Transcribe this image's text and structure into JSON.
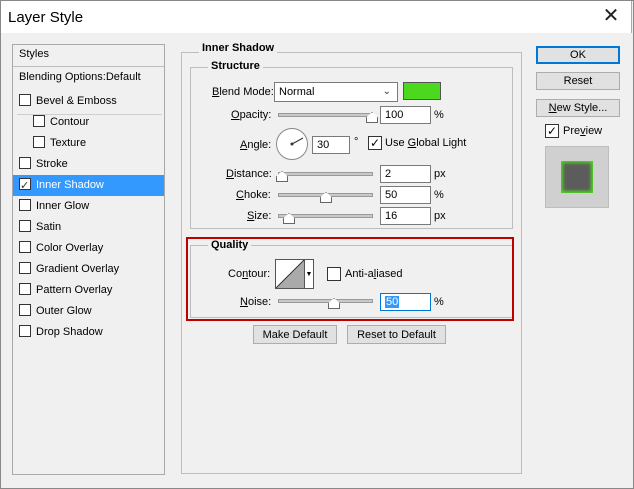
{
  "window": {
    "title": "Layer Style",
    "close": "✕"
  },
  "styles_panel": {
    "header": "Styles",
    "blending": "Blending Options:Default",
    "items": [
      {
        "label": "Bevel & Emboss",
        "checked": false
      },
      {
        "label": "Contour",
        "checked": false
      },
      {
        "label": "Texture",
        "checked": false
      },
      {
        "label": "Stroke",
        "checked": false
      },
      {
        "label": "Inner Shadow",
        "checked": true
      },
      {
        "label": "Inner Glow",
        "checked": false
      },
      {
        "label": "Satin",
        "checked": false
      },
      {
        "label": "Color Overlay",
        "checked": false
      },
      {
        "label": "Gradient Overlay",
        "checked": false
      },
      {
        "label": "Pattern Overlay",
        "checked": false
      },
      {
        "label": "Outer Glow",
        "checked": false
      },
      {
        "label": "Drop Shadow",
        "checked": false
      }
    ]
  },
  "inner_shadow": {
    "title": "Inner Shadow",
    "structure": {
      "title": "Structure",
      "blend_mode_label": "Blend Mode:",
      "blend_mode_value": "Normal",
      "color": "#4cd81f",
      "opacity_label": "Opacity:",
      "opacity_value": "100",
      "opacity_unit": "%",
      "angle_label": "Angle:",
      "angle_value": "30",
      "angle_unit": "°",
      "global_light_label": "Use Global Light",
      "global_light_checked": true,
      "distance_label": "Distance:",
      "distance_value": "2",
      "distance_unit": "px",
      "choke_label": "Choke:",
      "choke_value": "50",
      "choke_unit": "%",
      "size_label": "Size:",
      "size_value": "16",
      "size_unit": "px"
    },
    "quality": {
      "title": "Quality",
      "contour_label": "Contour:",
      "anti_aliased_label": "Anti-aliased",
      "anti_aliased_checked": false,
      "noise_label": "Noise:",
      "noise_value": "50",
      "noise_unit": "%"
    },
    "make_default": "Make Default",
    "reset_default": "Reset to Default"
  },
  "buttons": {
    "ok": "OK",
    "reset": "Reset",
    "new_style": "New Style...",
    "preview_label": "Preview",
    "preview_checked": true
  }
}
